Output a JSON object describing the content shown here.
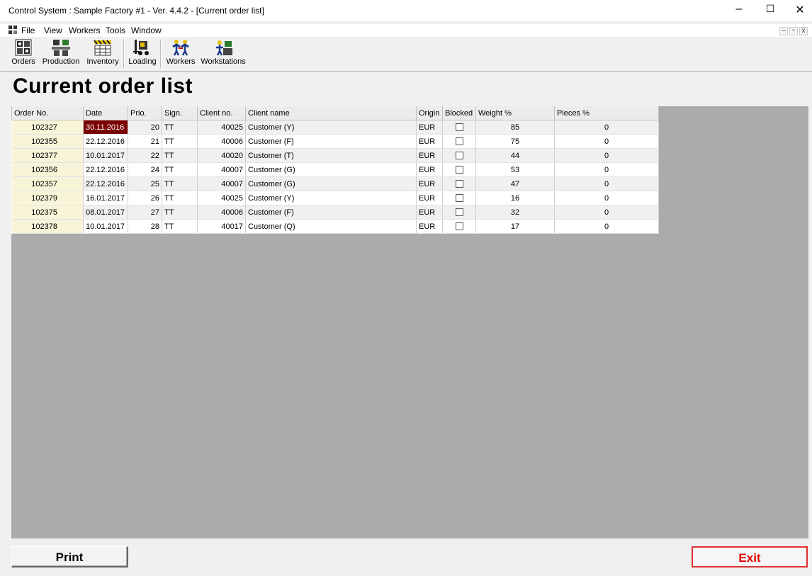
{
  "window": {
    "title": "Control System : Sample Factory #1  - Ver. 4.4.2 - [Current order list]",
    "minimize_glyph": "–",
    "maximize_glyph": "☐",
    "close_glyph": "✕",
    "mdi_minimize_glyph": "–",
    "mdi_restore_glyph": "▫",
    "mdi_close_glyph": "x"
  },
  "menu": {
    "items": [
      {
        "label": "File"
      },
      {
        "label": "View"
      },
      {
        "label": "Workers"
      },
      {
        "label": "Tools"
      },
      {
        "label": "Window"
      }
    ]
  },
  "toolbar": {
    "buttons": [
      {
        "label": "Orders",
        "icon": "orders-icon"
      },
      {
        "label": "Production",
        "icon": "production-icon"
      },
      {
        "label": "Inventory",
        "icon": "inventory-icon"
      },
      {
        "label": "Loading",
        "icon": "forklift-icon"
      },
      {
        "label": "Workers",
        "icon": "workers-icon"
      },
      {
        "label": "Workstations",
        "icon": "workstations-icon"
      }
    ]
  },
  "page": {
    "title": "Current order list"
  },
  "table": {
    "columns": [
      "Order No.",
      "Date",
      "Prio.",
      "Sign.",
      "Client no.",
      "Client name",
      "Origin",
      "Blocked",
      "Weight %",
      "Pieces %"
    ],
    "rows": [
      {
        "order_no": "102327",
        "date": "30.11.2016",
        "prio": "20",
        "sign": "TT",
        "client_no": "40025",
        "client_name": "Customer (Y)",
        "origin": "EUR",
        "blocked": false,
        "weight": "85",
        "pieces": "0"
      },
      {
        "order_no": "102355",
        "date": "22.12.2016",
        "prio": "21",
        "sign": "TT",
        "client_no": "40006",
        "client_name": "Customer (F)",
        "origin": "EUR",
        "blocked": false,
        "weight": "75",
        "pieces": "0"
      },
      {
        "order_no": "102377",
        "date": "10.01.2017",
        "prio": "22",
        "sign": "TT",
        "client_no": "40020",
        "client_name": "Customer (T)",
        "origin": "EUR",
        "blocked": false,
        "weight": "44",
        "pieces": "0"
      },
      {
        "order_no": "102356",
        "date": "22.12.2016",
        "prio": "24",
        "sign": "TT",
        "client_no": "40007",
        "client_name": "Customer (G)",
        "origin": "EUR",
        "blocked": false,
        "weight": "53",
        "pieces": "0"
      },
      {
        "order_no": "102357",
        "date": "22.12.2016",
        "prio": "25",
        "sign": "TT",
        "client_no": "40007",
        "client_name": "Customer (G)",
        "origin": "EUR",
        "blocked": false,
        "weight": "47",
        "pieces": "0"
      },
      {
        "order_no": "102379",
        "date": "16.01.2017",
        "prio": "26",
        "sign": "TT",
        "client_no": "40025",
        "client_name": "Customer (Y)",
        "origin": "EUR",
        "blocked": false,
        "weight": "16",
        "pieces": "0"
      },
      {
        "order_no": "102375",
        "date": "08.01.2017",
        "prio": "27",
        "sign": "TT",
        "client_no": "40006",
        "client_name": "Customer (F)",
        "origin": "EUR",
        "blocked": false,
        "weight": "32",
        "pieces": "0"
      },
      {
        "order_no": "102378",
        "date": "10.01.2017",
        "prio": "28",
        "sign": "TT",
        "client_no": "40017",
        "client_name": "Customer (Q)",
        "origin": "EUR",
        "blocked": false,
        "weight": "17",
        "pieces": "0"
      }
    ],
    "selected_date_color": "#7a0000",
    "order_cell_color": "#f7f4d8"
  },
  "footer": {
    "print_label": "Print",
    "exit_label": "Exit",
    "exit_color": "#e00000"
  }
}
